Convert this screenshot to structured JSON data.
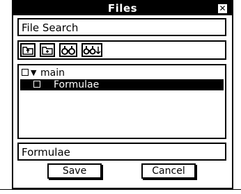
{
  "window": {
    "title": "Files"
  },
  "search": {
    "label": "File Search"
  },
  "toolbar": {
    "buttons": [
      {
        "icon": "up-folder-icon"
      },
      {
        "icon": "new-folder-icon"
      },
      {
        "icon": "find-icon"
      },
      {
        "icon": "find-next-icon"
      }
    ]
  },
  "tree": {
    "items": [
      {
        "label": "main",
        "expanded": true,
        "selected": false
      },
      {
        "label": "Formulae",
        "selected": true
      }
    ]
  },
  "filename": {
    "value": "Formulae"
  },
  "buttons": {
    "save": "Save",
    "cancel": "Cancel"
  }
}
